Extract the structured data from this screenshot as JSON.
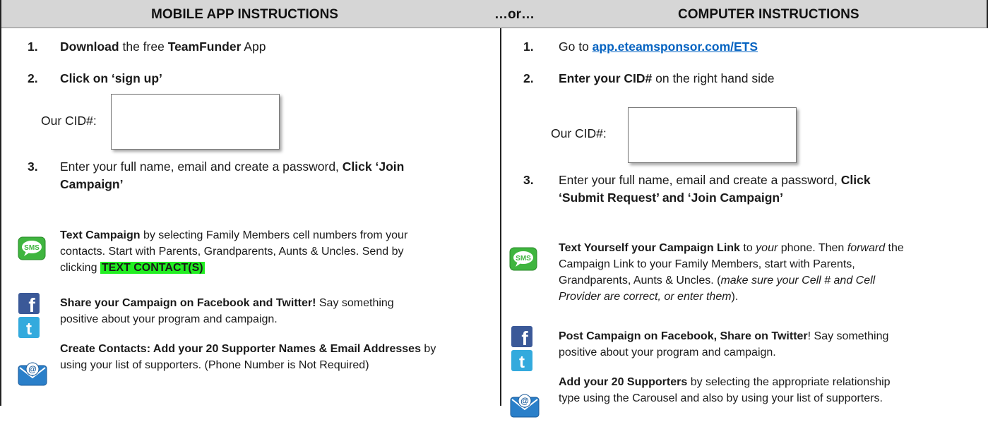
{
  "header": {
    "left_title": "MOBILE APP INSTRUCTIONS",
    "middle": "…or…",
    "right_title": "COMPUTER INSTRUCTIONS"
  },
  "mobile": {
    "step1": {
      "num": "1.",
      "bold1": "Download",
      "text1": " the free ",
      "bold2": "TeamFunder",
      "text2": " App"
    },
    "step2": {
      "num": "2.",
      "bold": "Click on ‘sign up’"
    },
    "cid_label": "Our CID#:",
    "step3": {
      "num": "3.",
      "text_line1": "Enter your full name, email and create a password, ",
      "bold_line1": "Click ‘Join",
      "bold_line2": "Campaign’"
    },
    "text": {
      "bold": "Text Campaign",
      "line1_rest": " by selecting Family Members cell numbers from your",
      "line2": "contacts. Start with Parents, Grandparents, Aunts & Uncles. Send by",
      "line3_prefix": "clicking ",
      "button": "TEXT CONTACT(S)"
    },
    "share": {
      "bold": "Share your Campaign on Facebook and Twitter!",
      "line1_rest": " Say something",
      "line2": "positive about your program and campaign."
    },
    "contacts": {
      "bold": "Create Contacts: Add your 20 Supporter Names & Email Addresses",
      "line1_rest": " by",
      "line2": "using your list of supporters. (Phone Number is Not Required)"
    }
  },
  "computer": {
    "step1": {
      "num": "1.",
      "text": "Go to ",
      "link": "app.eteamsponsor.com/ETS"
    },
    "step2": {
      "num": "2.",
      "bold": "Enter your CID#",
      "text": " on the right hand side"
    },
    "cid_label": "Our CID#:",
    "step3": {
      "num": "3.",
      "text_line1": "Enter your full name, email and create a password, ",
      "bold_line1": "Click",
      "bold_line2": "‘Submit Request’ and ‘Join Campaign’"
    },
    "text": {
      "bold": "Text Yourself your Campaign Link",
      "t1": " to ",
      "i1": "your",
      "t2": " phone. Then ",
      "i2": "forward",
      "t3": " the",
      "line2": "Campaign Link to your Family Members, start with Parents,",
      "line3_a": "Grandparents, Aunts & Uncles. (",
      "line3_i": "make sure your Cell # and Cell",
      "line4_i": "Provider are correct, or enter them",
      "line4_b": ")."
    },
    "post": {
      "bold": "Post Campaign on Facebook, Share on Twitter",
      "line1_rest": "! Say something",
      "line2": "positive about your program and campaign."
    },
    "supporters": {
      "bold": "Add your 20 Supporters",
      "line1_rest": " by selecting the appropriate relationship",
      "line2": "type using the Carousel and also by using your list of supporters."
    }
  },
  "icons": {
    "sms": "sms-icon",
    "facebook": "facebook-icon",
    "twitter": "twitter-icon",
    "email": "email-icon"
  },
  "sms_icon_text": "SMS",
  "colors": {
    "header_bg": "#d6d6d6",
    "highlight": "#22ee22",
    "link": "#0563c1",
    "facebook": "#3b5998",
    "twitter": "#33aadd",
    "sms_green": "#3fb53f"
  }
}
